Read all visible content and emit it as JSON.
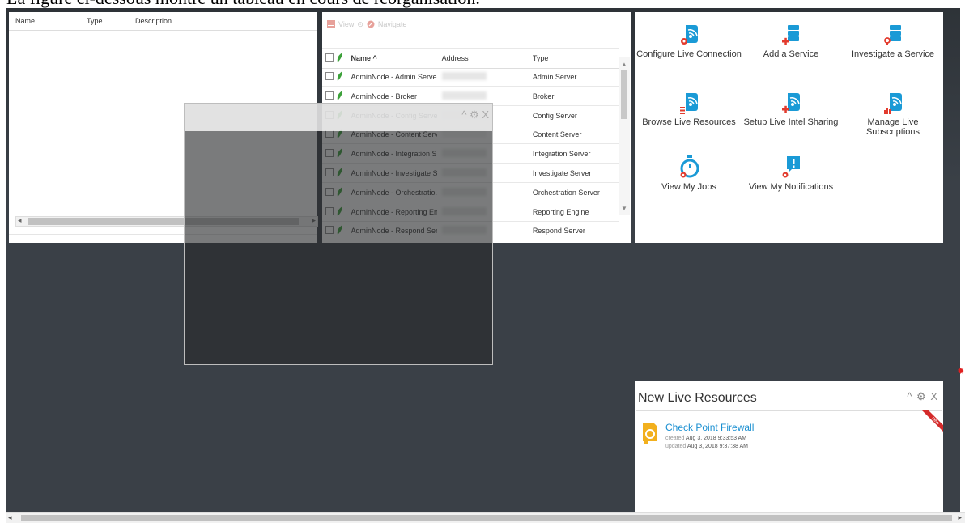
{
  "caption": "La figure ci-dessous montre un tableau en cours de réorganisation.",
  "panel_left": {
    "columns": [
      "Name",
      "Type",
      "Description"
    ]
  },
  "panel_services": {
    "toolbar": {
      "view": "View",
      "navigate": "Navigate"
    },
    "columns": {
      "name": "Name ^",
      "address": "Address",
      "type": "Type"
    },
    "rows": [
      {
        "name": "AdminNode - Admin Server",
        "type": "Admin Server"
      },
      {
        "name": "AdminNode - Broker",
        "type": "Broker"
      },
      {
        "name": "AdminNode - Config Server",
        "type": "Config Server"
      },
      {
        "name": "AdminNode - Content Server",
        "type": "Content Server"
      },
      {
        "name": "AdminNode - Integration S...",
        "type": "Integration Server"
      },
      {
        "name": "AdminNode - Investigate Se...",
        "type": "Investigate Server"
      },
      {
        "name": "AdminNode - Orchestratio...",
        "type": "Orchestration Server"
      },
      {
        "name": "AdminNode - Reporting En...",
        "type": "Reporting Engine"
      },
      {
        "name": "AdminNode - Respond Serv...",
        "type": "Respond Server"
      }
    ]
  },
  "panel_actions": {
    "items": [
      {
        "label": "Configure Live Connection",
        "icon": "live-gear-icon"
      },
      {
        "label": "Add a Service",
        "icon": "server-plus-icon"
      },
      {
        "label": "Investigate a Service",
        "icon": "server-search-icon"
      },
      {
        "label": "Browse Live Resources",
        "icon": "live-list-icon"
      },
      {
        "label": "Setup Live Intel Sharing",
        "icon": "live-share-icon"
      },
      {
        "label": "Manage Live Subscriptions",
        "icon": "live-subscriptions-icon"
      },
      {
        "label": "View My Jobs",
        "icon": "stopwatch-icon"
      },
      {
        "label": "View My Notifications",
        "icon": "notification-icon"
      }
    ],
    "accent": "#1a9ad6",
    "badge": "#e23b2e"
  },
  "panel_new_resources": {
    "title": "New Live Resources",
    "ribbon": "new",
    "item": {
      "name": "Check Point Firewall",
      "created_label": "created",
      "created_value": "Aug 3, 2018 9:33:53 AM",
      "updated_label": "updated",
      "updated_value": "Aug 3, 2018 9:37:38 AM"
    }
  },
  "window_controls": "^ ⚙ X"
}
